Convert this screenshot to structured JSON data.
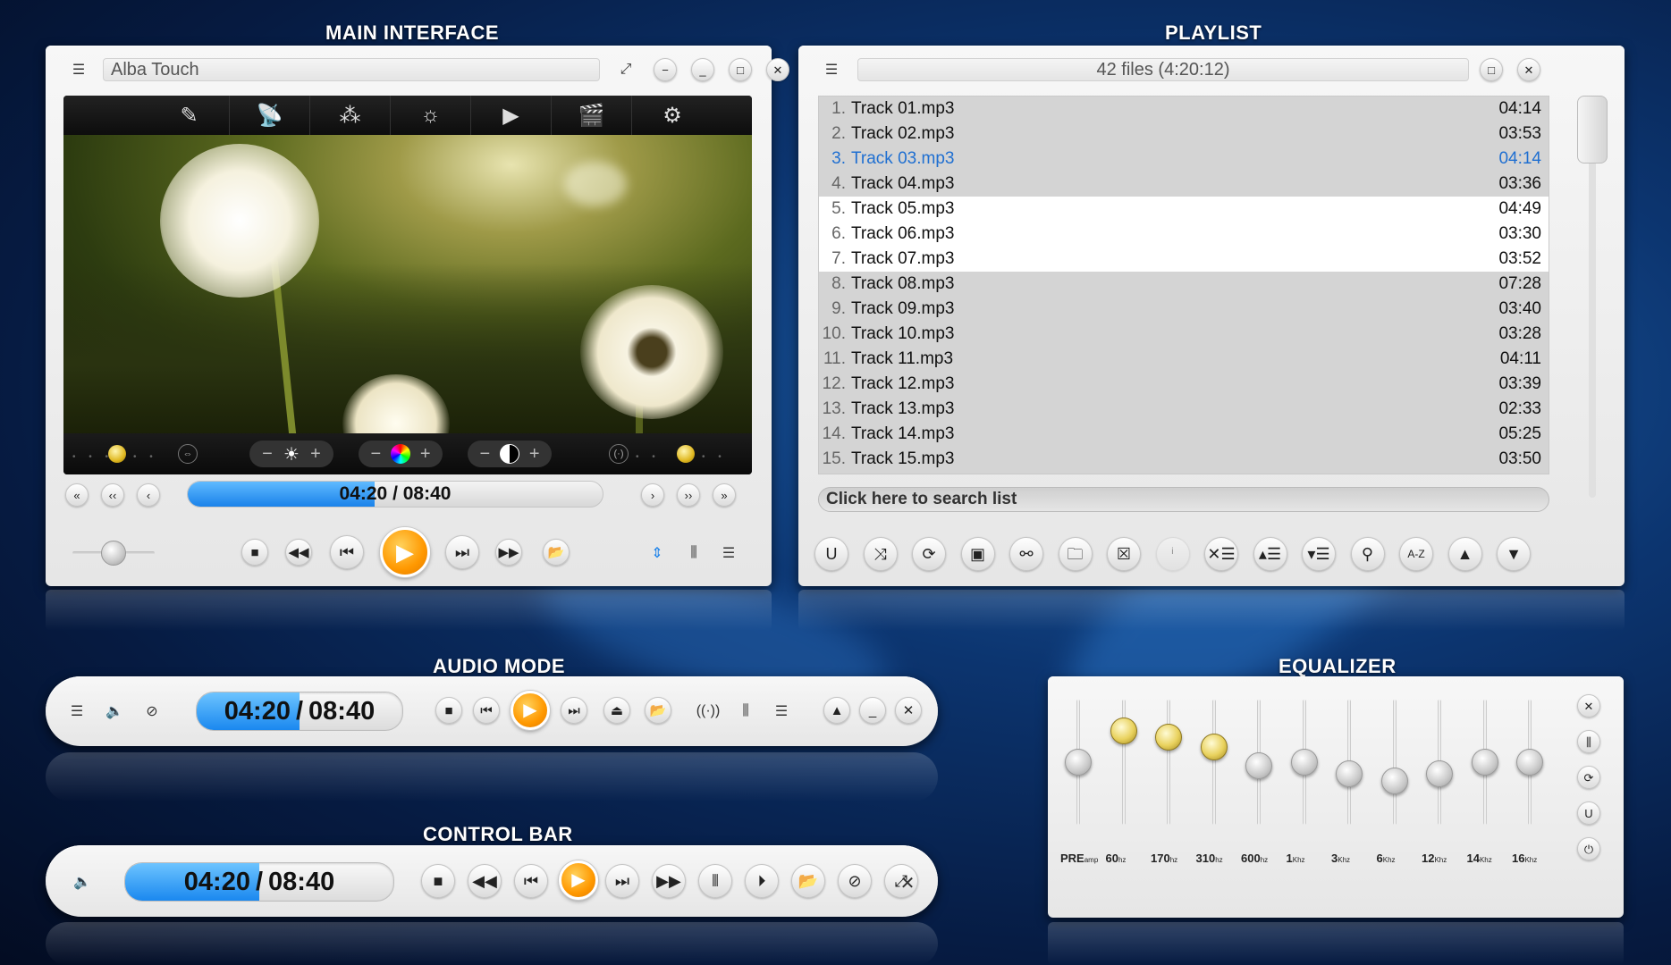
{
  "sections": {
    "main": "MAIN INTERFACE",
    "playlist": "PLAYLIST",
    "audio": "AUDIO MODE",
    "equalizer": "EQUALIZER",
    "control": "CONTROL BAR"
  },
  "main": {
    "title": "Alba Touch",
    "seek_time": "04:20 / 08:40",
    "seek_progress": 0.45,
    "volume_level": 0.5
  },
  "playlist": {
    "header": "42 files (4:20:12)",
    "search_placeholder": "Click here to search list",
    "tracks": [
      {
        "num": "1.",
        "name": "Track 01.mp3",
        "dur": "04:14"
      },
      {
        "num": "2.",
        "name": "Track 02.mp3",
        "dur": "03:53"
      },
      {
        "num": "3.",
        "name": "Track 03.mp3",
        "dur": "04:14"
      },
      {
        "num": "4.",
        "name": "Track 04.mp3",
        "dur": "03:36"
      },
      {
        "num": "5.",
        "name": "Track 05.mp3",
        "dur": "04:49"
      },
      {
        "num": "6.",
        "name": "Track 06.mp3",
        "dur": "03:30"
      },
      {
        "num": "7.",
        "name": "Track 07.mp3",
        "dur": "03:52"
      },
      {
        "num": "8.",
        "name": "Track 08.mp3",
        "dur": "07:28"
      },
      {
        "num": "9.",
        "name": "Track 09.mp3",
        "dur": "03:40"
      },
      {
        "num": "10.",
        "name": "Track 10.mp3",
        "dur": "03:28"
      },
      {
        "num": "11.",
        "name": "Track 11.mp3",
        "dur": "04:11"
      },
      {
        "num": "12.",
        "name": "Track 12.mp3",
        "dur": "03:39"
      },
      {
        "num": "13.",
        "name": "Track 13.mp3",
        "dur": "02:33"
      },
      {
        "num": "14.",
        "name": "Track 14.mp3",
        "dur": "05:25"
      },
      {
        "num": "15.",
        "name": "Track 15.mp3",
        "dur": "03:50"
      }
    ],
    "playing_index": 2,
    "selected_indexes": [
      4,
      5,
      6
    ]
  },
  "audio": {
    "time_current": "04:20",
    "time_total": "08:40",
    "progress": 0.5
  },
  "control": {
    "time_current": "04:20",
    "time_total": "08:40",
    "progress": 0.5
  },
  "equalizer": {
    "bands": [
      {
        "main": "PRE",
        "sub": "amp",
        "level": 0.5
      },
      {
        "main": "60",
        "sub": "hz",
        "level": 0.75,
        "gold": true
      },
      {
        "main": "170",
        "sub": "hz",
        "level": 0.7,
        "gold": true
      },
      {
        "main": "310",
        "sub": "hz",
        "level": 0.62,
        "gold": true
      },
      {
        "main": "600",
        "sub": "hz",
        "level": 0.47
      },
      {
        "main": "1",
        "sub": "Khz",
        "level": 0.5
      },
      {
        "main": "3",
        "sub": "Khz",
        "level": 0.41
      },
      {
        "main": "6",
        "sub": "Khz",
        "level": 0.35
      },
      {
        "main": "12",
        "sub": "Khz",
        "level": 0.41
      },
      {
        "main": "14",
        "sub": "Khz",
        "level": 0.5
      },
      {
        "main": "16",
        "sub": "Khz",
        "level": 0.5
      }
    ]
  },
  "colors": {
    "accent_blue": "#1a82ea",
    "play_orange": "#ff9800",
    "playing_text": "#1f6fd1"
  }
}
